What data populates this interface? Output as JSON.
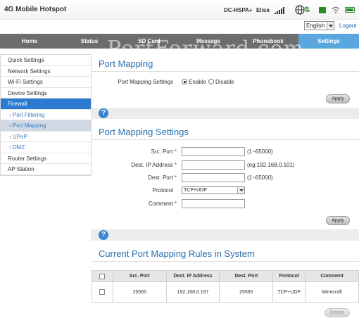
{
  "header": {
    "title": "4G Mobile Hotspot",
    "network_type": "DC-HSPA+",
    "carrier": "Elisa",
    "icons": [
      "signal-icon",
      "globe-icon",
      "data-transfer-icon",
      "sim-icon",
      "wifi-icon",
      "battery-icon"
    ]
  },
  "language": {
    "selected": "English",
    "logout": "Logout"
  },
  "nav": {
    "tabs": [
      {
        "label": "Home"
      },
      {
        "label": "Status"
      },
      {
        "label": "SD Card"
      },
      {
        "label": "Message"
      },
      {
        "label": "Phonebook"
      },
      {
        "label": "Settings"
      }
    ],
    "active": "Settings",
    "watermark": "PortForward.com"
  },
  "sidebar": {
    "items": [
      {
        "label": "Quick Settings"
      },
      {
        "label": "Network Settings"
      },
      {
        "label": "Wi-Fi Settings"
      },
      {
        "label": "Device Settings"
      },
      {
        "label": "Firewall"
      },
      {
        "label": "Port Filtering"
      },
      {
        "label": "Port Mapping"
      },
      {
        "label": "UPnP"
      },
      {
        "label": "DMZ"
      },
      {
        "label": "Router Settings"
      },
      {
        "label": "AP Station"
      }
    ]
  },
  "port_mapping": {
    "title": "Port Mapping",
    "setting_label": "Port Mapping Settings",
    "enable": "Enable",
    "disable": "Disable",
    "selected": "Enable",
    "apply": "Apply"
  },
  "help_icon": "?",
  "settings_form": {
    "title": "Port Mapping Settings",
    "src_port": {
      "label": "Src. Port",
      "required": "*",
      "value": "",
      "hint": "(1~65000)"
    },
    "dest_ip": {
      "label": "Dest. IP Address",
      "required": "*",
      "value": "",
      "hint": "(eg:192.168.0.101)"
    },
    "dest_port": {
      "label": "Dest. Port",
      "required": "*",
      "value": "",
      "hint": "(1~65000)"
    },
    "protocol": {
      "label": "Protocol",
      "value": "TCP+UDP"
    },
    "comment": {
      "label": "Comment",
      "required": "*",
      "value": ""
    },
    "apply": "Apply"
  },
  "rules": {
    "title": "Current Port Mapping Rules in System",
    "columns": [
      "Src. Port",
      "Dest. IP Address",
      "Dest. Port",
      "Protocol",
      "Comment"
    ],
    "rows": [
      {
        "src_port": "25565",
        "dest_ip": "192.168.0.197",
        "dest_port": "25565",
        "protocol": "TCP+UDP",
        "comment": "Minecraft"
      }
    ],
    "delete": "Delete"
  },
  "colors": {
    "accent": "#5aa7e0",
    "sidebar_active": "#2a7bd0",
    "title_blue": "#2a6fae",
    "nav_bg": "#6d6d6d",
    "status_green": "#2a8a2a"
  }
}
